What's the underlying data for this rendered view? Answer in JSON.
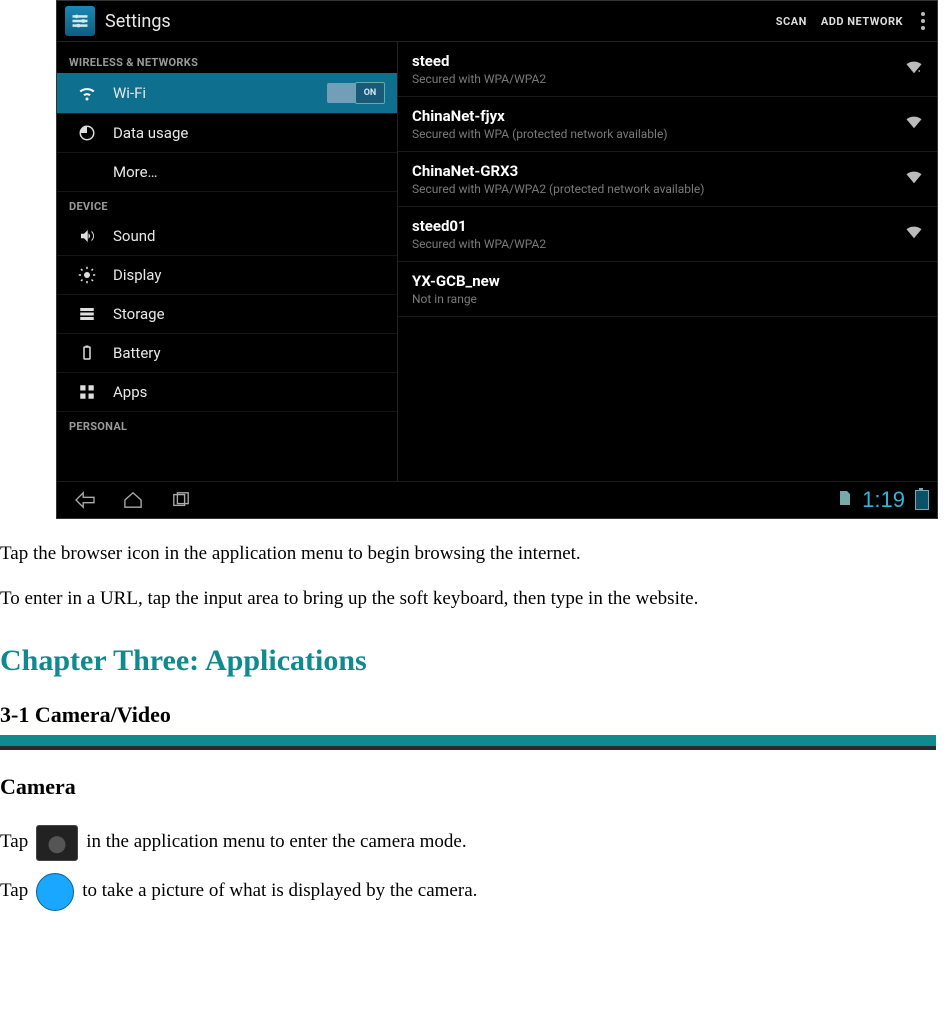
{
  "screenshot": {
    "app_title": "Settings",
    "actions": {
      "scan": "SCAN",
      "add_network": "ADD NETWORK"
    },
    "sections": {
      "wireless": "WIRELESS & NETWORKS",
      "device": "DEVICE",
      "personal": "PERSONAL"
    },
    "left_items": {
      "wifi": "Wi-Fi",
      "wifi_toggle": "ON",
      "data_usage": "Data usage",
      "more": "More…",
      "sound": "Sound",
      "display": "Display",
      "storage": "Storage",
      "battery": "Battery",
      "apps": "Apps"
    },
    "networks": [
      {
        "name": "steed",
        "sub": "Secured with WPA/WPA2",
        "signal": true
      },
      {
        "name": "ChinaNet-fjyx",
        "sub": "Secured with WPA (protected network available)",
        "signal": true
      },
      {
        "name": "ChinaNet-GRX3",
        "sub": "Secured with WPA/WPA2 (protected network available)",
        "signal": true
      },
      {
        "name": "steed01",
        "sub": "Secured with WPA/WPA2",
        "signal": true
      },
      {
        "name": "YX-GCB_new",
        "sub": "Not in range",
        "signal": false
      }
    ],
    "clock": "1:19"
  },
  "doc": {
    "p1": "Tap the browser icon in the application menu to begin browsing the internet.",
    "p2": "To enter in a URL, tap the input area to bring up the soft keyboard, then type in the website.",
    "chapter": "Chapter Three: Applications",
    "section": "3-1 Camera/Video",
    "subsection": "Camera",
    "cam_line_pre": "Tap",
    "cam_line_post": "in the application menu to enter the camera mode.",
    "shutter_line_pre": "Tap",
    "shutter_line_post": "to take a picture of what is displayed by the camera."
  }
}
